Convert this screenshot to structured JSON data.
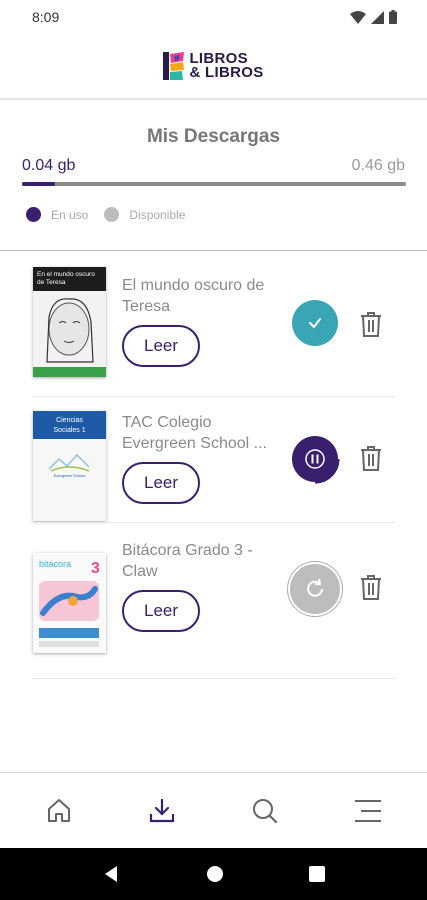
{
  "status_bar": {
    "time": "8:09"
  },
  "brand": {
    "line1": "LIBROS",
    "line2": "& LIBROS"
  },
  "storage": {
    "title": "Mis Descargas",
    "used": "0.04 gb",
    "available": "0.46 gb",
    "used_fraction": 0.087,
    "legend_used": "En uso",
    "legend_available": "Disponible",
    "colors": {
      "used": "#3a1f6e",
      "available": "#bdbdbd"
    }
  },
  "books": [
    {
      "title": "El mundo oscuro de Teresa",
      "cover_text": "En el mundo oscuro de Teresa",
      "read_label": "Leer",
      "status": "downloaded"
    },
    {
      "title": "TAC Colegio Evergreen School ...",
      "cover_text": "Ciencias Sociales 1",
      "read_label": "Leer",
      "status": "paused"
    },
    {
      "title": "Bitácora Grado 3 - Claw",
      "cover_text": "bitácora",
      "cover_number": "3",
      "read_label": "Leer",
      "status": "retry"
    }
  ],
  "bottom_nav": [
    {
      "name": "home",
      "icon": "home-icon"
    },
    {
      "name": "downloads",
      "icon": "download-icon",
      "active": true
    },
    {
      "name": "search",
      "icon": "search-icon"
    },
    {
      "name": "menu",
      "icon": "menu-icon"
    }
  ],
  "theme": {
    "primary": "#3a1f6e",
    "teal": "#3aa6b5",
    "grey": "#8a8a8a"
  }
}
